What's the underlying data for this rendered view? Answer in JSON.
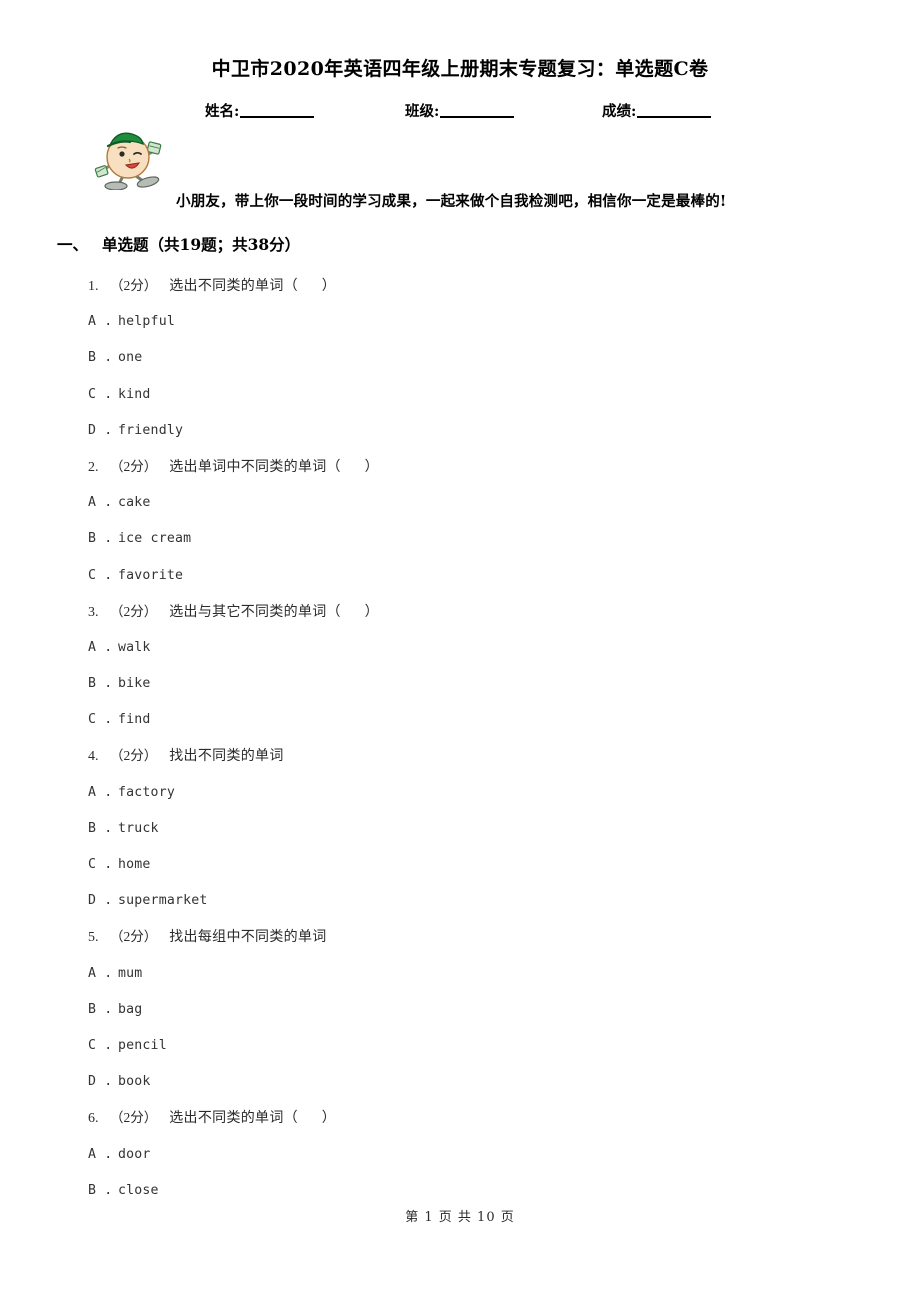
{
  "document": {
    "title": "中卫市2020年英语四年级上册期末专题复习：单选题C卷",
    "intro": "小朋友，带上你一段时间的学习成果，一起来做个自我检测吧，相信你一定是最棒的!",
    "footer": "第 1 页 共 10 页"
  },
  "identity": {
    "name_label": "姓名:",
    "class_label": "班级:",
    "score_label": "成绩:"
  },
  "section": {
    "number": "一、",
    "title": "单选题",
    "meta": "（共19题；共38分）"
  },
  "questions": [
    {
      "no": "1.",
      "score": "（2分）",
      "text": "选出不同类的单词（",
      "blank_close": "）",
      "options": [
        {
          "key": "A .",
          "value": "helpful"
        },
        {
          "key": "B .",
          "value": "one"
        },
        {
          "key": "C .",
          "value": "kind"
        },
        {
          "key": "D .",
          "value": "friendly"
        }
      ]
    },
    {
      "no": "2.",
      "score": "（2分）",
      "text": "选出单词中不同类的单词（",
      "blank_close": "）",
      "options": [
        {
          "key": "A .",
          "value": "cake"
        },
        {
          "key": "B .",
          "value": "ice cream"
        },
        {
          "key": "C .",
          "value": "favorite"
        }
      ]
    },
    {
      "no": "3.",
      "score": "（2分）",
      "text": "选出与其它不同类的单词（",
      "blank_close": "）",
      "options": [
        {
          "key": "A .",
          "value": "walk"
        },
        {
          "key": "B .",
          "value": "bike"
        },
        {
          "key": "C .",
          "value": "find"
        }
      ]
    },
    {
      "no": "4.",
      "score": "（2分）",
      "text": "找出不同类的单词",
      "blank_close": "",
      "options": [
        {
          "key": "A .",
          "value": "factory"
        },
        {
          "key": "B .",
          "value": "truck"
        },
        {
          "key": "C .",
          "value": "home"
        },
        {
          "key": "D .",
          "value": "supermarket"
        }
      ]
    },
    {
      "no": "5.",
      "score": "（2分）",
      "text": "找出每组中不同类的单词",
      "blank_close": "",
      "options": [
        {
          "key": "A .",
          "value": "mum"
        },
        {
          "key": "B .",
          "value": "bag"
        },
        {
          "key": "C .",
          "value": "pencil"
        },
        {
          "key": "D .",
          "value": "book"
        }
      ]
    },
    {
      "no": "6.",
      "score": "（2分）",
      "text": "选出不同类的单词（",
      "blank_close": "）",
      "options": [
        {
          "key": "A .",
          "value": "door"
        },
        {
          "key": "B .",
          "value": "close"
        }
      ]
    }
  ],
  "colors": {
    "page_background": "#ffffff",
    "text": "#1a1a1a",
    "body_text": "#2b2b2b",
    "mascot_face": "#f6d9b8",
    "mascot_hat": "#1e8a3c",
    "mascot_accent": "#9aa79a"
  },
  "mascot": {
    "icon_name": "student-mascot-icon"
  }
}
